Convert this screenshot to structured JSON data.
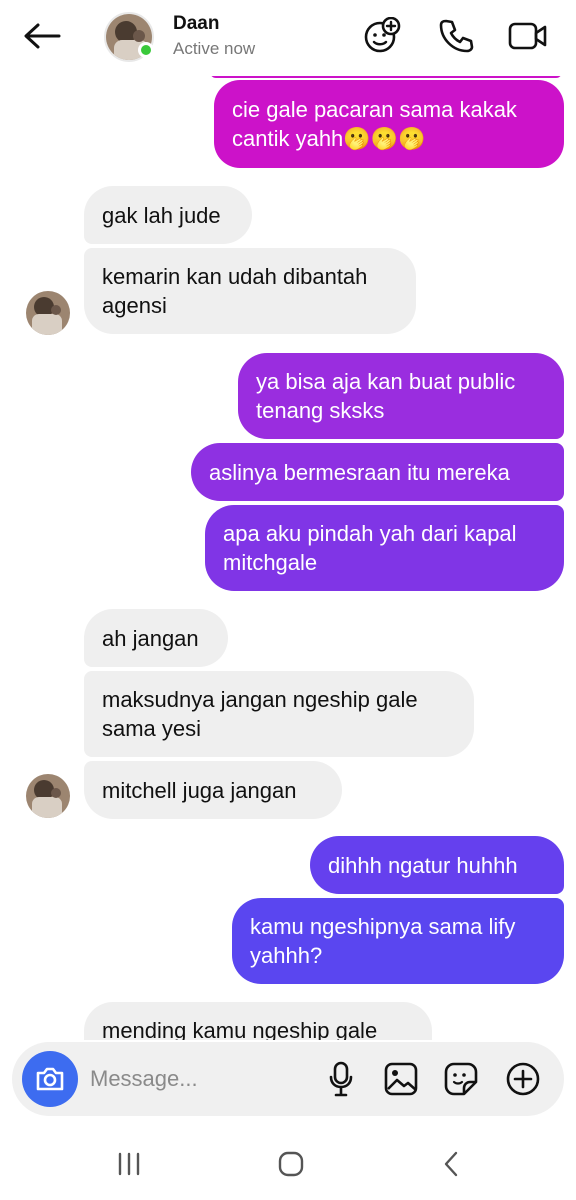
{
  "header": {
    "contact_name": "Daan",
    "status": "Active now",
    "icons": [
      "back-arrow-icon",
      "effects-icon",
      "phone-icon",
      "video-camera-icon"
    ]
  },
  "messages": [
    {
      "side": "out",
      "text": "cie gale pacaran sama kakak\ncantik yahh🫢🫢🫢",
      "color": "#cc12c9"
    },
    {
      "side": "in",
      "text": "gak lah jude"
    },
    {
      "side": "in",
      "text": "kemarin kan udah dibantah\nagensi"
    },
    {
      "side": "out",
      "text": "ya bisa aja kan buat public\ntenang sksks",
      "color": "#9a2ddf"
    },
    {
      "side": "out",
      "text": "aslinya bermesraan itu mereka",
      "color": "#8e31e2"
    },
    {
      "side": "out",
      "text": "apa aku pindah yah dari kapal\nmitchgale",
      "color": "#8035e6"
    },
    {
      "side": "in",
      "text": "ah jangan"
    },
    {
      "side": "in",
      "text": "maksudnya jangan ngeship gale\nsama yesi"
    },
    {
      "side": "in",
      "text": "mitchell juga jangan"
    },
    {
      "side": "out",
      "text": "dihhh ngatur huhhh",
      "color": "#6540ee"
    },
    {
      "side": "out",
      "text": "kamu ngeshipnya sama lify\nyahhh?",
      "color": "#5a46f0"
    },
    {
      "side": "in",
      "text": "mending kamu ngeship gale"
    }
  ],
  "composer": {
    "placeholder": "Message...",
    "icons": [
      "camera-icon",
      "microphone-icon",
      "gallery-icon",
      "sticker-icon",
      "plus-icon"
    ]
  },
  "navbar": {
    "icons": [
      "recent-apps-icon",
      "home-icon",
      "back-icon"
    ]
  },
  "colors": {
    "incoming_bubble": "#efefef",
    "camera_button": "#3d6cf0",
    "online": "#3ac93a"
  }
}
